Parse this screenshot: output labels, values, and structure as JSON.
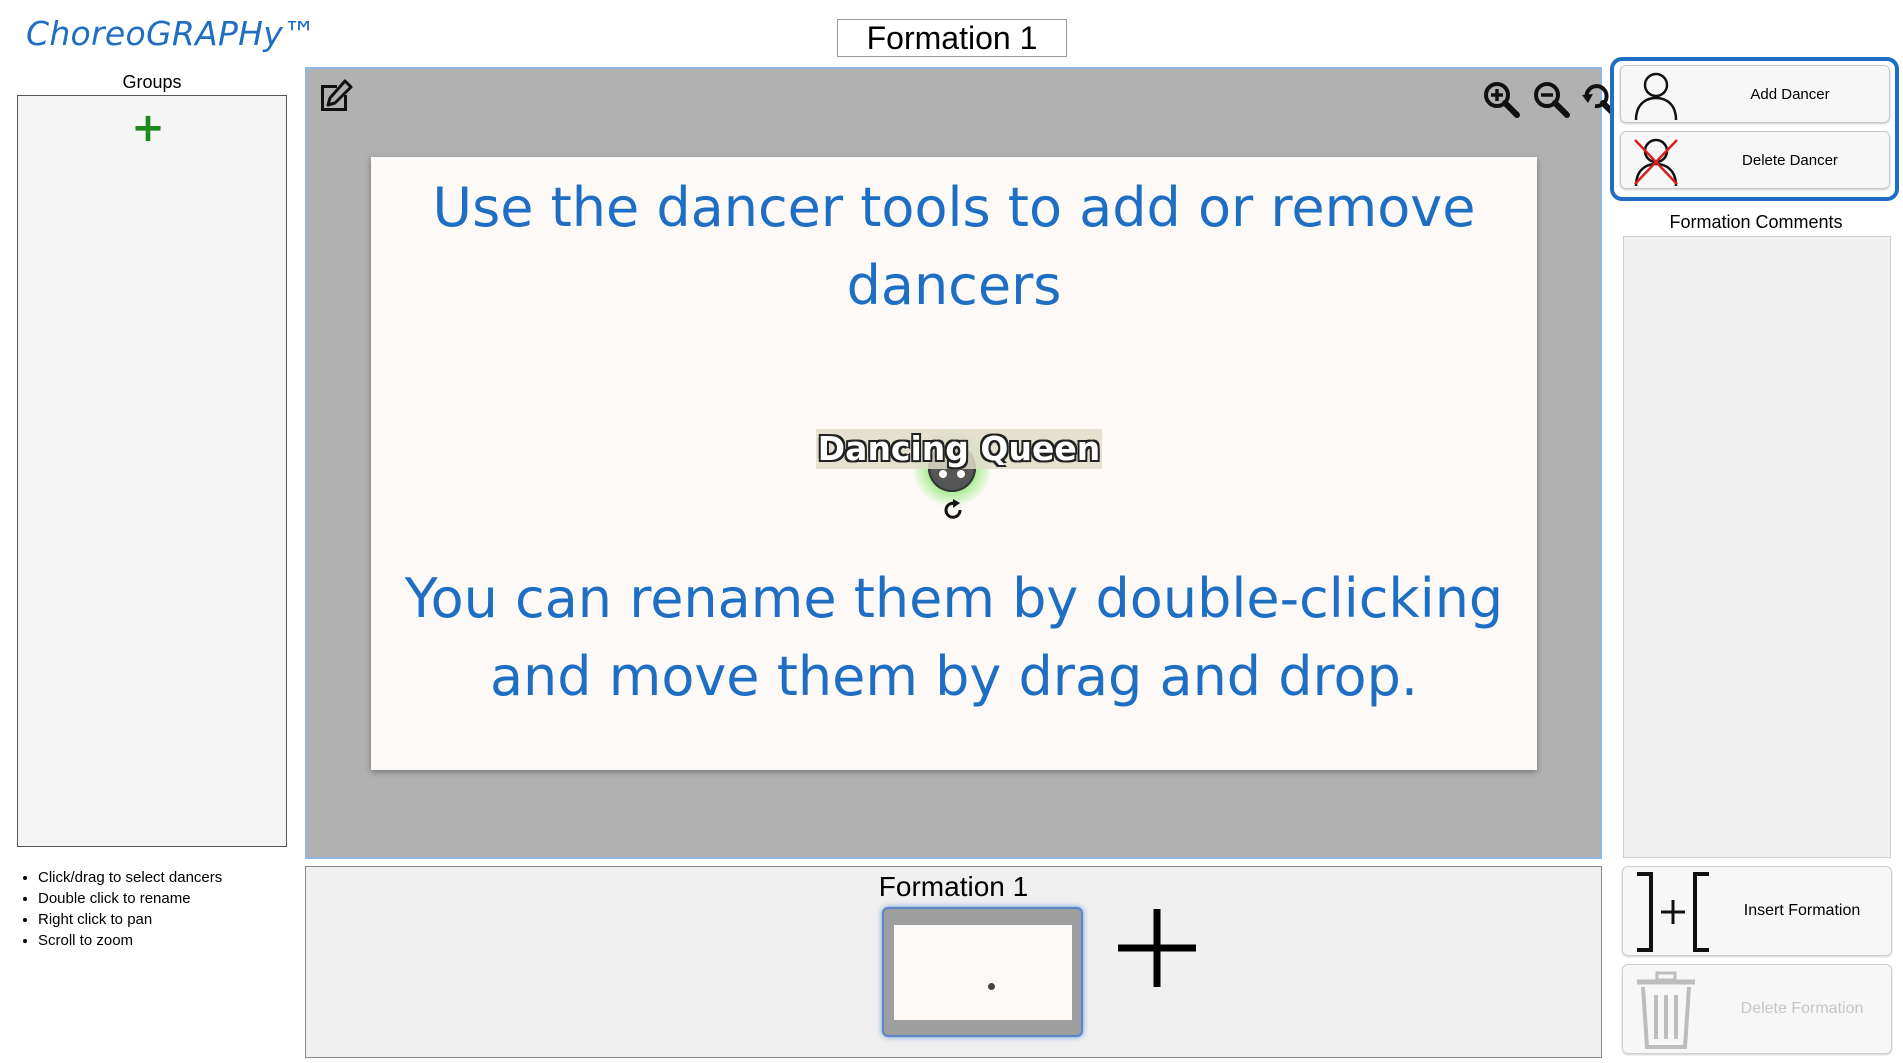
{
  "app": {
    "title": "ChoreoGRAPHy™"
  },
  "header": {
    "formation_name": "Formation 1"
  },
  "groups": {
    "label": "Groups",
    "add_symbol": "+"
  },
  "help": {
    "items": [
      "Click/drag to select dancers",
      "Double click to rename",
      "Right click to pan",
      "Scroll to zoom"
    ]
  },
  "stage": {
    "instruction_top": "Use the dancer tools to add or remove dancers",
    "instruction_bottom": "You can rename them by double-clicking and move them by drag and drop.",
    "dancer": {
      "name": "Dancing Queen",
      "selected": true
    }
  },
  "dancer_tools": {
    "add_label": "Add Dancer",
    "delete_label": "Delete Dancer"
  },
  "comments": {
    "label": "Formation Comments",
    "value": ""
  },
  "formation_actions": {
    "insert_label": "Insert Formation",
    "delete_label": "Delete Formation",
    "delete_enabled": false
  },
  "timeline": {
    "current_label": "Formation 1",
    "formations": [
      {
        "name": "Formation 1",
        "dancer_count": 1,
        "selected": true
      }
    ]
  },
  "colors": {
    "accent": "#1e6fc4",
    "stage_bg": "#b1b1b1",
    "floor": "#fdf9f6",
    "add_green": "#1c8a1c",
    "delete_red": "#d92020"
  },
  "icons": [
    "edit-icon",
    "zoom-in-icon",
    "zoom-out-icon",
    "zoom-reset-icon",
    "user-icon",
    "user-delete-icon",
    "rotate-icon",
    "insert-formation-icon",
    "trash-icon",
    "plus-icon"
  ]
}
